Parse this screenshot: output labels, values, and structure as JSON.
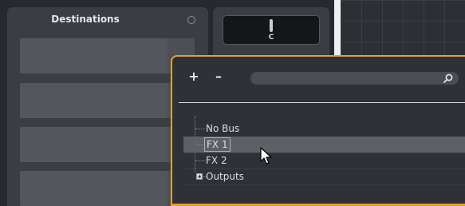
{
  "destinations": {
    "title": "Destinations"
  },
  "pan": {
    "label": "C"
  },
  "popup": {
    "add_label": "+",
    "remove_label": "–",
    "search": {
      "value": "",
      "placeholder": ""
    },
    "items": [
      {
        "label": "No Bus",
        "selected": false,
        "expandable": false
      },
      {
        "label": "FX 1",
        "selected": true,
        "expandable": false
      },
      {
        "label": "FX 2",
        "selected": false,
        "expandable": false
      },
      {
        "label": "Outputs",
        "selected": false,
        "expandable": true
      }
    ]
  },
  "colors": {
    "accent": "#e7a02b",
    "selection": "#5d6166",
    "panel": "#3a3e43",
    "background": "#26292d"
  },
  "icons": [
    "search-icon",
    "expand-plus-icon",
    "mouse-pointer-icon"
  ]
}
